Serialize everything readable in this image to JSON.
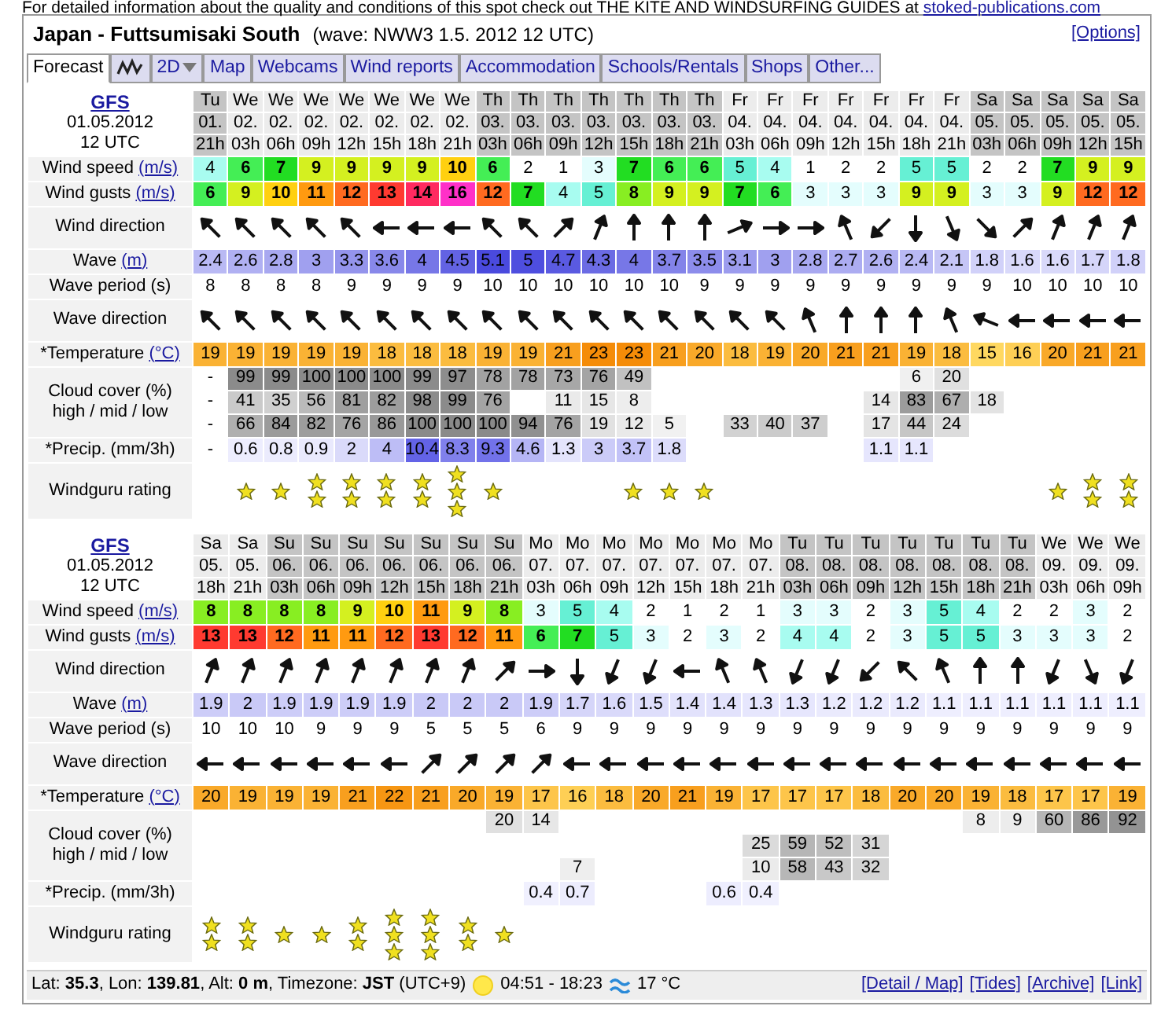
{
  "notice": {
    "text": "For detailed information about the quality and conditions of this spot check out THE KITE AND WINDSURFING GUIDES at",
    "link": "stoked-publications.com"
  },
  "header": {
    "title": "Japan - Futtsumisaki South",
    "subtitle": "(wave: NWW3 1.5. 2012 12 UTC)",
    "options": "[Options]"
  },
  "tabs": [
    {
      "kind": "text",
      "label": "Forecast",
      "selected": true
    },
    {
      "kind": "graph",
      "selected": false
    },
    {
      "kind": "dropdown",
      "label": "2D",
      "selected": false
    },
    {
      "kind": "text",
      "label": "Map",
      "selected": false
    },
    {
      "kind": "text",
      "label": "Webcams",
      "selected": false
    },
    {
      "kind": "text",
      "label": "Wind reports",
      "selected": false
    },
    {
      "kind": "text",
      "label": "Accommodation",
      "selected": false
    },
    {
      "kind": "text",
      "label": "Schools/Rentals",
      "selected": false
    },
    {
      "kind": "text",
      "label": "Shops",
      "selected": false
    },
    {
      "kind": "text",
      "label": "Other...",
      "selected": false
    }
  ],
  "blocks": [
    {
      "model": "GFS",
      "date": "01.05.2012",
      "run": "12 UTC",
      "rows": [
        {
          "kind": "speed",
          "label": "Wind speed",
          "unit": "(m/s)"
        },
        {
          "kind": "gusts",
          "label": "Wind gusts",
          "unit": "(m/s)"
        },
        {
          "kind": "wind_direction",
          "label": "Wind direction"
        },
        {
          "kind": "wave",
          "label": "Wave",
          "unit": "(m)"
        },
        {
          "kind": "period",
          "label": "Wave period (s)"
        },
        {
          "kind": "wave_direction",
          "label": "Wave direction"
        },
        {
          "kind": "temperature",
          "label": "*Temperature",
          "unit": "(°C)"
        },
        {
          "kind": "cloud",
          "label": "Cloud cover (%)",
          "sublabel": "high / mid / low"
        },
        {
          "kind": "precipitation",
          "label": "*Precip. (mm/3h)"
        },
        {
          "kind": "rating",
          "label": "Windguru rating"
        }
      ],
      "columns": [
        {
          "day": "Tu",
          "date": "01.",
          "hour": "21h",
          "shaded": true,
          "speed": "4",
          "gusts": "6",
          "wind_arrow": {
            "kind": "NW"
          },
          "wave": "2.4",
          "period": "8",
          "wave_arrow": {
            "kind": "NW"
          },
          "temp": "19",
          "cloud_high": "-",
          "cloud_mid": "-",
          "cloud_low": "-",
          "precip": "-"
        },
        {
          "day": "We",
          "date": "02.",
          "hour": "03h",
          "shaded": false,
          "speed": "6",
          "gusts": "9",
          "wind_arrow": {
            "kind": "NW"
          },
          "wave": "2.6",
          "period": "8",
          "wave_arrow": {
            "kind": "NW"
          },
          "temp": "19",
          "cloud_high": "99",
          "cloud_mid": "41",
          "cloud_low": "66",
          "precip": "0.6",
          "rating": [
            {
              "kind": "star"
            }
          ]
        },
        {
          "day": "We",
          "date": "02.",
          "hour": "06h",
          "shaded": false,
          "speed": "7",
          "gusts": "10",
          "wind_arrow": {
            "kind": "NW"
          },
          "wave": "2.8",
          "period": "8",
          "wave_arrow": {
            "kind": "NW"
          },
          "temp": "19",
          "cloud_high": "99",
          "cloud_mid": "35",
          "cloud_low": "84",
          "precip": "0.8",
          "rating": [
            {
              "kind": "star"
            }
          ]
        },
        {
          "day": "We",
          "date": "02.",
          "hour": "09h",
          "shaded": false,
          "speed": "9",
          "gusts": "11",
          "wind_arrow": {
            "kind": "NW"
          },
          "wave": "3",
          "period": "8",
          "wave_arrow": {
            "kind": "NW"
          },
          "temp": "19",
          "cloud_high": "100",
          "cloud_mid": "56",
          "cloud_low": "82",
          "precip": "0.9",
          "rating": [
            {
              "kind": "star"
            },
            {
              "kind": "star"
            }
          ]
        },
        {
          "day": "We",
          "date": "02.",
          "hour": "12h",
          "shaded": false,
          "speed": "9",
          "gusts": "12",
          "wind_arrow": {
            "kind": "NW"
          },
          "wave": "3.3",
          "period": "9",
          "wave_arrow": {
            "kind": "NW"
          },
          "temp": "19",
          "cloud_high": "100",
          "cloud_mid": "81",
          "cloud_low": "76",
          "precip": "2",
          "rating": [
            {
              "kind": "star"
            },
            {
              "kind": "star"
            }
          ]
        },
        {
          "day": "We",
          "date": "02.",
          "hour": "15h",
          "shaded": false,
          "speed": "9",
          "gusts": "13",
          "wind_arrow": {
            "kind": "W"
          },
          "wave": "3.6",
          "period": "9",
          "wave_arrow": {
            "kind": "NW"
          },
          "temp": "18",
          "cloud_high": "100",
          "cloud_mid": "82",
          "cloud_low": "86",
          "precip": "4",
          "rating": [
            {
              "kind": "star"
            },
            {
              "kind": "star"
            }
          ]
        },
        {
          "day": "We",
          "date": "02.",
          "hour": "18h",
          "shaded": false,
          "speed": "9",
          "gusts": "14",
          "wind_arrow": {
            "kind": "W"
          },
          "wave": "4",
          "period": "9",
          "wave_arrow": {
            "kind": "NW"
          },
          "temp": "18",
          "cloud_high": "99",
          "cloud_mid": "98",
          "cloud_low": "100",
          "precip": "10.4",
          "rating": [
            {
              "kind": "star"
            },
            {
              "kind": "star"
            }
          ]
        },
        {
          "day": "We",
          "date": "02.",
          "hour": "21h",
          "shaded": false,
          "speed": "10",
          "gusts": "16",
          "wind_arrow": {
            "kind": "W"
          },
          "wave": "4.5",
          "period": "9",
          "wave_arrow": {
            "kind": "NW"
          },
          "temp": "18",
          "cloud_high": "97",
          "cloud_mid": "99",
          "cloud_low": "100",
          "precip": "8.3",
          "rating": [
            {
              "kind": "star"
            },
            {
              "kind": "star"
            },
            {
              "kind": "star"
            }
          ]
        },
        {
          "day": "Th",
          "date": "03.",
          "hour": "03h",
          "shaded": true,
          "speed": "6",
          "gusts": "12",
          "wind_arrow": {
            "kind": "NW"
          },
          "wave": "5.1",
          "period": "10",
          "wave_arrow": {
            "kind": "NW"
          },
          "temp": "19",
          "cloud_high": "78",
          "cloud_mid": "76",
          "cloud_low": "100",
          "precip": "9.3",
          "rating": [
            {
              "kind": "star"
            }
          ]
        },
        {
          "day": "Th",
          "date": "03.",
          "hour": "06h",
          "shaded": true,
          "speed": "2",
          "gusts": "7",
          "wind_arrow": {
            "kind": "NW"
          },
          "wave": "5",
          "period": "10",
          "wave_arrow": {
            "kind": "NW"
          },
          "temp": "19",
          "cloud_high": "78",
          "cloud_low": "94",
          "precip": "4.6"
        },
        {
          "day": "Th",
          "date": "03.",
          "hour": "09h",
          "shaded": true,
          "speed": "1",
          "gusts": "4",
          "wind_arrow": {
            "kind": "NE"
          },
          "wave": "4.7",
          "period": "10",
          "wave_arrow": {
            "kind": "NW"
          },
          "temp": "21",
          "cloud_high": "73",
          "cloud_mid": "11",
          "cloud_low": "76",
          "precip": "1.3"
        },
        {
          "day": "Th",
          "date": "03.",
          "hour": "12h",
          "shaded": true,
          "speed": "3",
          "gusts": "5",
          "wind_arrow": {
            "kind": "NNE"
          },
          "wave": "4.3",
          "period": "10",
          "wave_arrow": {
            "kind": "NW"
          },
          "temp": "23",
          "cloud_high": "76",
          "cloud_mid": "15",
          "cloud_low": "19",
          "precip": "3"
        },
        {
          "day": "Th",
          "date": "03.",
          "hour": "15h",
          "shaded": true,
          "speed": "7",
          "gusts": "8",
          "wind_arrow": {
            "kind": "N"
          },
          "wave": "4",
          "period": "10",
          "wave_arrow": {
            "kind": "NW"
          },
          "temp": "23",
          "cloud_high": "49",
          "cloud_mid": "8",
          "cloud_low": "12",
          "precip": "3.7",
          "rating": [
            {
              "kind": "star"
            }
          ]
        },
        {
          "day": "Th",
          "date": "03.",
          "hour": "18h",
          "shaded": true,
          "speed": "6",
          "gusts": "9",
          "wind_arrow": {
            "kind": "N"
          },
          "wave": "3.7",
          "period": "10",
          "wave_arrow": {
            "kind": "NW"
          },
          "temp": "21",
          "cloud_low": "5",
          "precip": "1.8",
          "rating": [
            {
              "kind": "star"
            }
          ]
        },
        {
          "day": "Th",
          "date": "03.",
          "hour": "21h",
          "shaded": true,
          "speed": "6",
          "gusts": "9",
          "wind_arrow": {
            "kind": "N"
          },
          "wave": "3.5",
          "period": "9",
          "wave_arrow": {
            "kind": "NW"
          },
          "temp": "20",
          "rating": [
            {
              "kind": "star"
            }
          ]
        },
        {
          "day": "Fr",
          "date": "04.",
          "hour": "03h",
          "shaded": false,
          "speed": "5",
          "gusts": "7",
          "wind_arrow": {
            "kind": "ENE"
          },
          "wave": "3.1",
          "period": "9",
          "wave_arrow": {
            "kind": "NW"
          },
          "temp": "18",
          "cloud_low": "33"
        },
        {
          "day": "Fr",
          "date": "04.",
          "hour": "06h",
          "shaded": false,
          "speed": "4",
          "gusts": "6",
          "wind_arrow": {
            "kind": "E"
          },
          "wave": "3",
          "period": "9",
          "wave_arrow": {
            "kind": "NW"
          },
          "temp": "19",
          "cloud_low": "40"
        },
        {
          "day": "Fr",
          "date": "04.",
          "hour": "09h",
          "shaded": false,
          "speed": "1",
          "gusts": "3",
          "wind_arrow": {
            "kind": "E"
          },
          "wave": "2.8",
          "period": "9",
          "wave_arrow": {
            "kind": "NNW"
          },
          "temp": "20",
          "cloud_low": "37"
        },
        {
          "day": "Fr",
          "date": "04.",
          "hour": "12h",
          "shaded": false,
          "speed": "2",
          "gusts": "3",
          "wind_arrow": {
            "kind": "NNW"
          },
          "wave": "2.7",
          "period": "9",
          "wave_arrow": {
            "kind": "N"
          },
          "temp": "21"
        },
        {
          "day": "Fr",
          "date": "04.",
          "hour": "15h",
          "shaded": false,
          "speed": "2",
          "gusts": "3",
          "wind_arrow": {
            "kind": "SW"
          },
          "wave": "2.6",
          "period": "9",
          "wave_arrow": {
            "kind": "N"
          },
          "temp": "21",
          "cloud_mid": "14",
          "cloud_low": "17",
          "precip": "1.1"
        },
        {
          "day": "Fr",
          "date": "04.",
          "hour": "18h",
          "shaded": false,
          "speed": "5",
          "gusts": "9",
          "wind_arrow": {
            "kind": "S"
          },
          "wave": "2.4",
          "period": "9",
          "wave_arrow": {
            "kind": "N"
          },
          "temp": "19",
          "cloud_high": "6",
          "cloud_mid": "83",
          "cloud_low": "44",
          "precip": "1.1"
        },
        {
          "day": "Fr",
          "date": "04.",
          "hour": "21h",
          "shaded": false,
          "speed": "5",
          "gusts": "9",
          "wind_arrow": {
            "kind": "SSE"
          },
          "wave": "2.1",
          "period": "9",
          "wave_arrow": {
            "kind": "NNW"
          },
          "temp": "18",
          "cloud_high": "20",
          "cloud_mid": "67",
          "cloud_low": "24"
        },
        {
          "day": "Sa",
          "date": "05.",
          "hour": "03h",
          "shaded": true,
          "speed": "2",
          "gusts": "3",
          "wind_arrow": {
            "kind": "SE"
          },
          "wave": "1.8",
          "period": "9",
          "wave_arrow": {
            "kind": "WNW"
          },
          "temp": "15",
          "cloud_mid": "18"
        },
        {
          "day": "Sa",
          "date": "05.",
          "hour": "06h",
          "shaded": true,
          "speed": "2",
          "gusts": "3",
          "wind_arrow": {
            "kind": "NE"
          },
          "wave": "1.6",
          "period": "10",
          "wave_arrow": {
            "kind": "W"
          },
          "temp": "16"
        },
        {
          "day": "Sa",
          "date": "05.",
          "hour": "09h",
          "shaded": true,
          "speed": "7",
          "gusts": "9",
          "wind_arrow": {
            "kind": "NNE"
          },
          "wave": "1.6",
          "period": "10",
          "wave_arrow": {
            "kind": "W"
          },
          "temp": "20",
          "rating": [
            {
              "kind": "star"
            }
          ]
        },
        {
          "day": "Sa",
          "date": "05.",
          "hour": "12h",
          "shaded": true,
          "speed": "9",
          "gusts": "12",
          "wind_arrow": {
            "kind": "NNE"
          },
          "wave": "1.7",
          "period": "10",
          "wave_arrow": {
            "kind": "W"
          },
          "temp": "21",
          "rating": [
            {
              "kind": "star"
            },
            {
              "kind": "star"
            }
          ]
        },
        {
          "day": "Sa",
          "date": "05.",
          "hour": "15h",
          "shaded": true,
          "speed": "9",
          "gusts": "12",
          "wind_arrow": {
            "kind": "NNE"
          },
          "wave": "1.8",
          "period": "10",
          "wave_arrow": {
            "kind": "W"
          },
          "temp": "21",
          "rating": [
            {
              "kind": "star"
            },
            {
              "kind": "star"
            }
          ]
        }
      ]
    },
    {
      "model": "GFS",
      "date": "01.05.2012",
      "run": "12 UTC",
      "rows": [
        {
          "kind": "speed",
          "label": "Wind speed",
          "unit": "(m/s)"
        },
        {
          "kind": "gusts",
          "label": "Wind gusts",
          "unit": "(m/s)"
        },
        {
          "kind": "wind_direction",
          "label": "Wind direction"
        },
        {
          "kind": "wave",
          "label": "Wave",
          "unit": "(m)"
        },
        {
          "kind": "period",
          "label": "Wave period (s)"
        },
        {
          "kind": "wave_direction",
          "label": "Wave direction"
        },
        {
          "kind": "temperature",
          "label": "*Temperature",
          "unit": "(°C)"
        },
        {
          "kind": "cloud",
          "label": "Cloud cover (%)",
          "sublabel": "high / mid / low"
        },
        {
          "kind": "precipitation",
          "label": "*Precip. (mm/3h)"
        },
        {
          "kind": "rating",
          "label": "Windguru rating"
        }
      ],
      "columns": [
        {
          "day": "Sa",
          "date": "05.",
          "hour": "18h",
          "shaded": false,
          "speed": "8",
          "gusts": "13",
          "wind_arrow": {
            "kind": "NNE"
          },
          "wave": "1.9",
          "period": "10",
          "wave_arrow": {
            "kind": "W"
          },
          "temp": "20",
          "rating": [
            {
              "kind": "star"
            },
            {
              "kind": "star"
            }
          ]
        },
        {
          "day": "Sa",
          "date": "05.",
          "hour": "21h",
          "shaded": false,
          "speed": "8",
          "gusts": "13",
          "wind_arrow": {
            "kind": "NNE"
          },
          "wave": "2",
          "period": "10",
          "wave_arrow": {
            "kind": "W"
          },
          "temp": "19",
          "rating": [
            {
              "kind": "star"
            },
            {
              "kind": "star"
            }
          ]
        },
        {
          "day": "Su",
          "date": "06.",
          "hour": "03h",
          "shaded": true,
          "speed": "8",
          "gusts": "12",
          "wind_arrow": {
            "kind": "NNE"
          },
          "wave": "1.9",
          "period": "10",
          "wave_arrow": {
            "kind": "W"
          },
          "temp": "19",
          "rating": [
            {
              "kind": "star"
            }
          ]
        },
        {
          "day": "Su",
          "date": "06.",
          "hour": "06h",
          "shaded": true,
          "speed": "8",
          "gusts": "11",
          "wind_arrow": {
            "kind": "NNE"
          },
          "wave": "1.9",
          "period": "9",
          "wave_arrow": {
            "kind": "W"
          },
          "temp": "19",
          "rating": [
            {
              "kind": "star"
            }
          ]
        },
        {
          "day": "Su",
          "date": "06.",
          "hour": "09h",
          "shaded": true,
          "speed": "9",
          "gusts": "11",
          "wind_arrow": {
            "kind": "NNE"
          },
          "wave": "1.9",
          "period": "9",
          "wave_arrow": {
            "kind": "W"
          },
          "temp": "21",
          "rating": [
            {
              "kind": "star"
            },
            {
              "kind": "star"
            }
          ]
        },
        {
          "day": "Su",
          "date": "06.",
          "hour": "12h",
          "shaded": true,
          "speed": "10",
          "gusts": "12",
          "wind_arrow": {
            "kind": "NNE"
          },
          "wave": "1.9",
          "period": "9",
          "wave_arrow": {
            "kind": "W"
          },
          "temp": "22",
          "rating": [
            {
              "kind": "star"
            },
            {
              "kind": "star"
            },
            {
              "kind": "star"
            }
          ]
        },
        {
          "day": "Su",
          "date": "06.",
          "hour": "15h",
          "shaded": true,
          "speed": "11",
          "gusts": "13",
          "wind_arrow": {
            "kind": "NNE"
          },
          "wave": "2",
          "period": "5",
          "wave_arrow": {
            "kind": "NE"
          },
          "temp": "21",
          "rating": [
            {
              "kind": "star"
            },
            {
              "kind": "star"
            },
            {
              "kind": "star"
            }
          ]
        },
        {
          "day": "Su",
          "date": "06.",
          "hour": "18h",
          "shaded": true,
          "speed": "9",
          "gusts": "12",
          "wind_arrow": {
            "kind": "NNE"
          },
          "wave": "2",
          "period": "5",
          "wave_arrow": {
            "kind": "NE"
          },
          "temp": "20",
          "rating": [
            {
              "kind": "star"
            },
            {
              "kind": "star"
            }
          ]
        },
        {
          "day": "Su",
          "date": "06.",
          "hour": "21h",
          "shaded": true,
          "speed": "8",
          "gusts": "11",
          "wind_arrow": {
            "kind": "NE"
          },
          "wave": "2",
          "period": "5",
          "wave_arrow": {
            "kind": "NE"
          },
          "temp": "19",
          "cloud_high": "20",
          "rating": [
            {
              "kind": "star"
            }
          ]
        },
        {
          "day": "Mo",
          "date": "07.",
          "hour": "03h",
          "shaded": false,
          "speed": "3",
          "gusts": "6",
          "wind_arrow": {
            "kind": "E"
          },
          "wave": "1.9",
          "period": "6",
          "wave_arrow": {
            "kind": "NE"
          },
          "temp": "17",
          "cloud_high": "14",
          "precip": "0.4"
        },
        {
          "day": "Mo",
          "date": "07.",
          "hour": "06h",
          "shaded": false,
          "speed": "5",
          "gusts": "7",
          "wind_arrow": {
            "kind": "S"
          },
          "wave": "1.7",
          "period": "9",
          "wave_arrow": {
            "kind": "W"
          },
          "temp": "16",
          "cloud_low": "7",
          "precip": "0.7"
        },
        {
          "day": "Mo",
          "date": "07.",
          "hour": "09h",
          "shaded": false,
          "speed": "4",
          "gusts": "5",
          "wind_arrow": {
            "kind": "SSW"
          },
          "wave": "1.6",
          "period": "9",
          "wave_arrow": {
            "kind": "W"
          },
          "temp": "18"
        },
        {
          "day": "Mo",
          "date": "07.",
          "hour": "12h",
          "shaded": false,
          "speed": "2",
          "gusts": "3",
          "wind_arrow": {
            "kind": "SSW"
          },
          "wave": "1.5",
          "period": "9",
          "wave_arrow": {
            "kind": "W"
          },
          "temp": "20"
        },
        {
          "day": "Mo",
          "date": "07.",
          "hour": "15h",
          "shaded": false,
          "speed": "1",
          "gusts": "2",
          "wind_arrow": {
            "kind": "W"
          },
          "wave": "1.4",
          "period": "9",
          "wave_arrow": {
            "kind": "W"
          },
          "temp": "21"
        },
        {
          "day": "Mo",
          "date": "07.",
          "hour": "18h",
          "shaded": false,
          "speed": "2",
          "gusts": "3",
          "wind_arrow": {
            "kind": "NNW"
          },
          "wave": "1.4",
          "period": "9",
          "wave_arrow": {
            "kind": "W"
          },
          "temp": "19",
          "precip": "0.6"
        },
        {
          "day": "Mo",
          "date": "07.",
          "hour": "21h",
          "shaded": false,
          "speed": "1",
          "gusts": "2",
          "wind_arrow": {
            "kind": "NNW"
          },
          "wave": "1.3",
          "period": "9",
          "wave_arrow": {
            "kind": "W"
          },
          "temp": "17",
          "cloud_mid": "25",
          "cloud_low": "10",
          "precip": "0.4"
        },
        {
          "day": "Tu",
          "date": "08.",
          "hour": "03h",
          "shaded": true,
          "speed": "3",
          "gusts": "4",
          "wind_arrow": {
            "kind": "SSW"
          },
          "wave": "1.3",
          "period": "9",
          "wave_arrow": {
            "kind": "W"
          },
          "temp": "17",
          "cloud_mid": "59",
          "cloud_low": "58"
        },
        {
          "day": "Tu",
          "date": "08.",
          "hour": "06h",
          "shaded": true,
          "speed": "3",
          "gusts": "4",
          "wind_arrow": {
            "kind": "SSW"
          },
          "wave": "1.2",
          "period": "9",
          "wave_arrow": {
            "kind": "W"
          },
          "temp": "17",
          "cloud_mid": "52",
          "cloud_low": "43"
        },
        {
          "day": "Tu",
          "date": "08.",
          "hour": "09h",
          "shaded": true,
          "speed": "2",
          "gusts": "2",
          "wind_arrow": {
            "kind": "SW"
          },
          "wave": "1.2",
          "period": "9",
          "wave_arrow": {
            "kind": "W"
          },
          "temp": "18",
          "cloud_mid": "31",
          "cloud_low": "32"
        },
        {
          "day": "Tu",
          "date": "08.",
          "hour": "12h",
          "shaded": true,
          "speed": "3",
          "gusts": "3",
          "wind_arrow": {
            "kind": "NW"
          },
          "wave": "1.2",
          "period": "9",
          "wave_arrow": {
            "kind": "W"
          },
          "temp": "20"
        },
        {
          "day": "Tu",
          "date": "08.",
          "hour": "15h",
          "shaded": true,
          "speed": "5",
          "gusts": "5",
          "wind_arrow": {
            "kind": "NNW"
          },
          "wave": "1.1",
          "period": "9",
          "wave_arrow": {
            "kind": "W"
          },
          "temp": "20"
        },
        {
          "day": "Tu",
          "date": "08.",
          "hour": "18h",
          "shaded": true,
          "speed": "4",
          "gusts": "5",
          "wind_arrow": {
            "kind": "N"
          },
          "wave": "1.1",
          "period": "9",
          "wave_arrow": {
            "kind": "W"
          },
          "temp": "19",
          "cloud_high": "8"
        },
        {
          "day": "Tu",
          "date": "08.",
          "hour": "21h",
          "shaded": true,
          "speed": "2",
          "gusts": "3",
          "wind_arrow": {
            "kind": "N"
          },
          "wave": "1.1",
          "period": "9",
          "wave_arrow": {
            "kind": "W"
          },
          "temp": "18",
          "cloud_high": "9"
        },
        {
          "day": "We",
          "date": "09.",
          "hour": "03h",
          "shaded": false,
          "speed": "2",
          "gusts": "3",
          "wind_arrow": {
            "kind": "SSW"
          },
          "wave": "1.1",
          "period": "9",
          "wave_arrow": {
            "kind": "W"
          },
          "temp": "17",
          "cloud_high": "60"
        },
        {
          "day": "We",
          "date": "09.",
          "hour": "06h",
          "shaded": false,
          "speed": "3",
          "gusts": "3",
          "wind_arrow": {
            "kind": "SSE"
          },
          "wave": "1.1",
          "period": "9",
          "wave_arrow": {
            "kind": "W"
          },
          "temp": "17",
          "cloud_high": "86"
        },
        {
          "day": "We",
          "date": "09.",
          "hour": "09h",
          "shaded": false,
          "speed": "2",
          "gusts": "2",
          "wind_arrow": {
            "kind": "SSW"
          },
          "wave": "1.1",
          "period": "9",
          "wave_arrow": {
            "kind": "W"
          },
          "temp": "19",
          "cloud_high": "92"
        }
      ]
    }
  ],
  "footer": {
    "location": "Lat: **35.3**, Lon: **139.81**, Alt: **0 m**, Timezone: **JST** (UTC+9)",
    "sun": "04:51 - 18:23",
    "water_temp": "17 °C",
    "links": [
      "[Detail / Map]",
      "[Tides]",
      "[Archive]",
      "[Link]"
    ]
  }
}
